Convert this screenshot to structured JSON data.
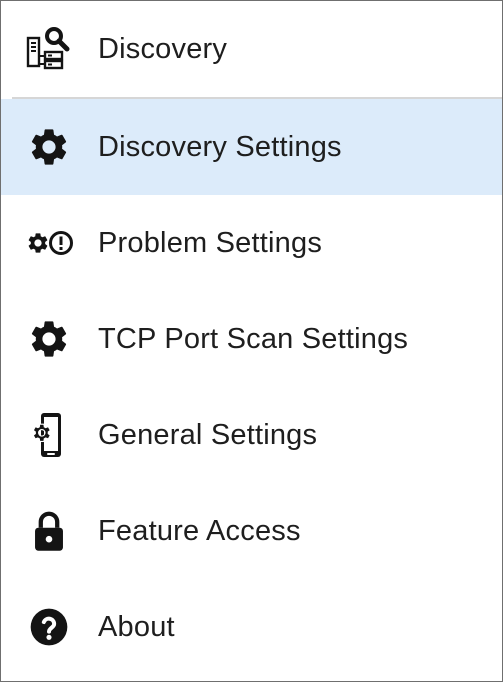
{
  "menu": {
    "header": {
      "label": "Discovery",
      "icon": "discovery-servers-search-icon"
    },
    "items": [
      {
        "label": "Discovery Settings",
        "icon": "gear-icon",
        "selected": true
      },
      {
        "label": "Problem Settings",
        "icon": "gear-alert-icon",
        "selected": false
      },
      {
        "label": "TCP Port Scan Settings",
        "icon": "gear-icon",
        "selected": false
      },
      {
        "label": "General Settings",
        "icon": "device-gear-icon",
        "selected": false
      },
      {
        "label": "Feature Access",
        "icon": "lock-icon",
        "selected": false
      },
      {
        "label": "About",
        "icon": "help-circle-icon",
        "selected": false
      }
    ]
  },
  "colors": {
    "selected_background": "#dcebfa",
    "text": "#1e1e1e",
    "icon": "#141414",
    "divider": "#d6d6d6"
  }
}
